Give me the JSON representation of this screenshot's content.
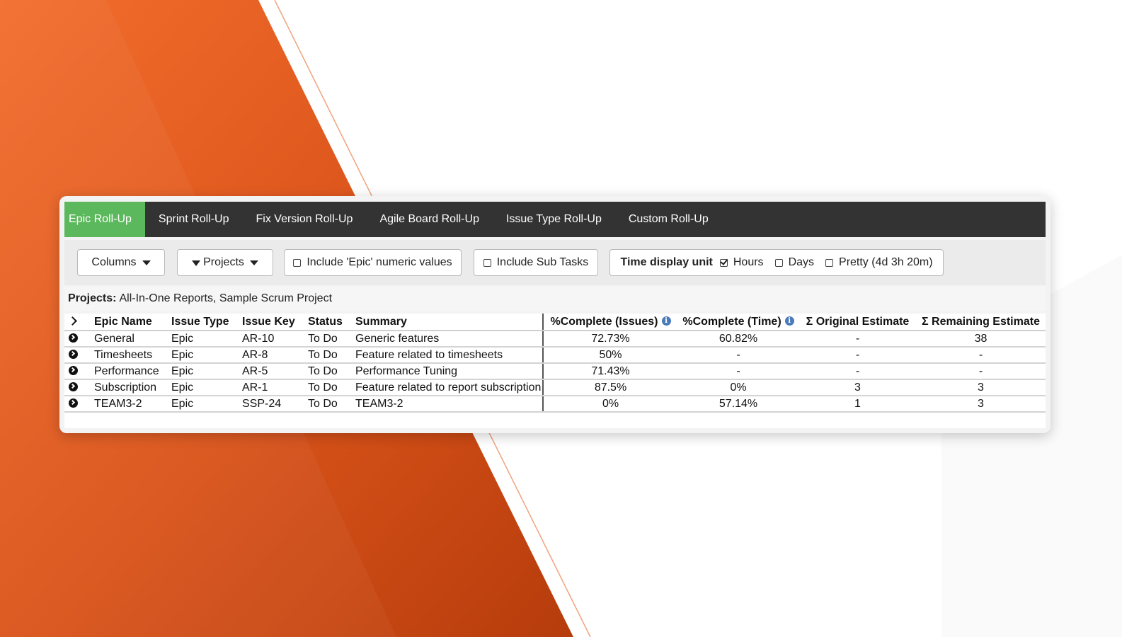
{
  "tabs": [
    {
      "label": "Epic Roll-Up",
      "active": true
    },
    {
      "label": "Sprint Roll-Up",
      "active": false
    },
    {
      "label": "Fix Version Roll-Up",
      "active": false
    },
    {
      "label": "Agile Board Roll-Up",
      "active": false
    },
    {
      "label": "Issue Type Roll-Up",
      "active": false
    },
    {
      "label": "Custom Roll-Up",
      "active": false
    }
  ],
  "toolbar": {
    "columns_label": "Columns",
    "projects_label": "Projects",
    "include_epic_label": "Include 'Epic' numeric values",
    "include_epic_checked": false,
    "include_subtasks_label": "Include Sub Tasks",
    "include_subtasks_checked": false,
    "time_unit_label": "Time display unit",
    "time_units": [
      {
        "label": "Hours",
        "checked": true
      },
      {
        "label": "Days",
        "checked": false
      },
      {
        "label": "Pretty (4d 3h 20m)",
        "checked": false
      }
    ]
  },
  "projects": {
    "label": "Projects:",
    "value": "All-In-One Reports, Sample Scrum Project"
  },
  "table": {
    "headers": {
      "epic_name": "Epic Name",
      "issue_type": "Issue Type",
      "issue_key": "Issue Key",
      "status": "Status",
      "summary": "Summary",
      "pct_issues": "%Complete (Issues)",
      "pct_time": "%Complete (Time)",
      "orig_est": "Σ Original Estimate",
      "rem_est": "Σ Remaining Estimate"
    },
    "rows": [
      {
        "epic_name": "General",
        "issue_type": "Epic",
        "issue_key": "AR-10",
        "status": "To Do",
        "summary": "Generic features",
        "pct_issues": "72.73%",
        "pct_time": "60.82%",
        "orig_est": "-",
        "rem_est": "38"
      },
      {
        "epic_name": "Timesheets",
        "issue_type": "Epic",
        "issue_key": "AR-8",
        "status": "To Do",
        "summary": "Feature related to timesheets",
        "pct_issues": "50%",
        "pct_time": "-",
        "orig_est": "-",
        "rem_est": "-"
      },
      {
        "epic_name": "Performance",
        "issue_type": "Epic",
        "issue_key": "AR-5",
        "status": "To Do",
        "summary": "Performance Tuning",
        "pct_issues": "71.43%",
        "pct_time": "-",
        "orig_est": "-",
        "rem_est": "-"
      },
      {
        "epic_name": "Subscription",
        "issue_type": "Epic",
        "issue_key": "AR-1",
        "status": "To Do",
        "summary": "Feature related to report subscription",
        "pct_issues": "87.5%",
        "pct_time": "0%",
        "orig_est": "3",
        "rem_est": "3"
      },
      {
        "epic_name": "TEAM3-2",
        "issue_type": "Epic",
        "issue_key": "SSP-24",
        "status": "To Do",
        "summary": "TEAM3-2",
        "pct_issues": "0%",
        "pct_time": "57.14%",
        "orig_est": "1",
        "rem_est": "3"
      }
    ]
  },
  "colors": {
    "active_tab": "#5cb85c",
    "tab_bar": "#333333",
    "info_icon": "#4a7ab8",
    "background_orange": "#e05a1c"
  }
}
